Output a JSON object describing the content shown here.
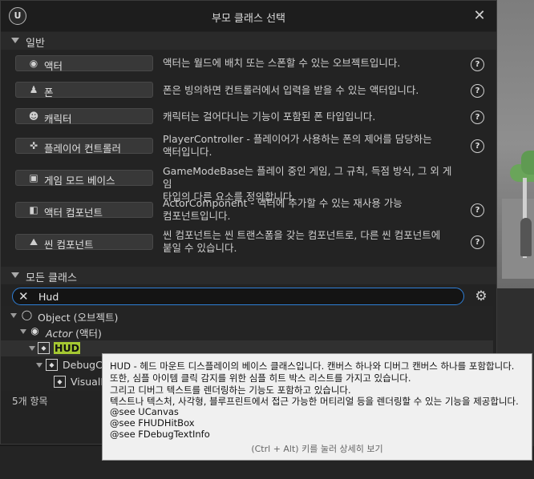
{
  "window": {
    "title": "부모 클래스 선택"
  },
  "common_section": {
    "header": "일반",
    "items": [
      {
        "label": "액터",
        "icon": "actor-icon",
        "desc_lines": [
          "액터는 월드에 배치 또는 스폰할 수 있는 오브젝트입니다."
        ]
      },
      {
        "label": "폰",
        "icon": "pawn-icon",
        "desc_lines": [
          "폰은 빙의하면 컨트롤러에서 입력을 받을 수 있는 액터입니다."
        ]
      },
      {
        "label": "캐릭터",
        "icon": "character-icon",
        "desc_lines": [
          "캐릭터는 걸어다니는 기능이 포함된 폰 타입입니다."
        ]
      },
      {
        "label": "플레이어 컨트롤러",
        "icon": "gamepad-icon",
        "desc_lines": [
          "PlayerController - 플레이어가 사용하는 폰의 제어를 담당하는",
          "액터입니다."
        ]
      },
      {
        "label": "게임 모드 베이스",
        "icon": "game-mode-icon",
        "desc_lines": [
          "GameModeBase는 플레이 중인 게임, 그 규칙, 득점 방식, 그 외 게임",
          "타입의 다른 요소를 정의합니다."
        ]
      },
      {
        "label": "액터 컴포넌트",
        "icon": "actor-component-icon",
        "desc_lines": [
          "ActorComponent - 액터에 추가할 수 있는 재사용 가능",
          "컴포넌트입니다."
        ]
      },
      {
        "label": "씬 컴포넌트",
        "icon": "scene-component-icon",
        "desc_lines": [
          "씬 컴포넌트는 씬 트랜스폼을 갖는 컴포넌트로, 다른 씬 컴포넌트에",
          "붙일 수 있습니다."
        ]
      }
    ]
  },
  "all_classes": {
    "header": "모든 클래스",
    "search_value": "Hud",
    "tree": [
      {
        "label": "Object (오브젝트)",
        "icon": "object-icon"
      },
      {
        "label": "Actor",
        "suffix": " (액터)",
        "icon": "actor-icon"
      },
      {
        "label": "HUD",
        "icon": "hud-class-icon",
        "highlight": true
      },
      {
        "label": "DebugCa",
        "icon": "debug-class-icon"
      },
      {
        "label": "VisualL",
        "icon": "visual-class-icon"
      }
    ],
    "count": "5개 항목"
  },
  "tooltip": {
    "lines": [
      "HUD - 헤드 마운트 디스플레이의 베이스 클래스입니다. 캔버스 하나와 디버그 캔버스 하나를 포함합니다.",
      "또한, 심플 아이템 클릭 감지를 위한 심플 히트 박스 리스트를 가지고 있습니다.",
      "그리고 디버그 텍스트를 렌더링하는 기능도 포함하고 있습니다.",
      "텍스트나 텍스처, 사각형, 블루프린트에서 접근 가능한 머티리얼 등을 렌더링할 수 있는 기능을 제공합니다.",
      "@see UCanvas",
      "@see FHUDHitBox",
      "@see FDebugTextInfo"
    ],
    "footer": "(Ctrl + Alt) 키를 눌러 상세히 보기"
  },
  "colors": {
    "accent": "#2f7fd7",
    "highlight": "#a5c832"
  }
}
